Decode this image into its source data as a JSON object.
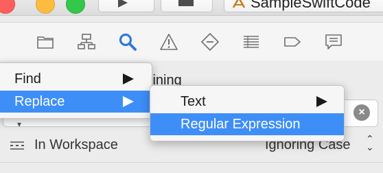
{
  "toolbar": {
    "scheme_title": "SampleSwiftCode"
  },
  "navigator": {
    "icons": [
      "folder-icon",
      "hierarchy-icon",
      "search-icon",
      "warning-icon",
      "breakpoint-diamond-icon",
      "report-list-icon",
      "tag-icon",
      "comment-icon"
    ],
    "active_icon": "search-icon",
    "accent_color": "#2f7ad8"
  },
  "find_bar": {
    "background_text": "jining",
    "scope_label": "In Workspace",
    "case_label": "Ignoring Case"
  },
  "main_menu": {
    "items": [
      {
        "label": "Find",
        "selected": false
      },
      {
        "label": "Replace",
        "selected": true
      }
    ]
  },
  "sub_menu": {
    "items": [
      {
        "label": "Text",
        "selected": false
      },
      {
        "label": "Regular Expression",
        "selected": true
      }
    ]
  },
  "colors": {
    "selection": "#3e8ef7",
    "close": "#fc605c",
    "minimize": "#fdbc40",
    "zoom": "#34c84a"
  }
}
